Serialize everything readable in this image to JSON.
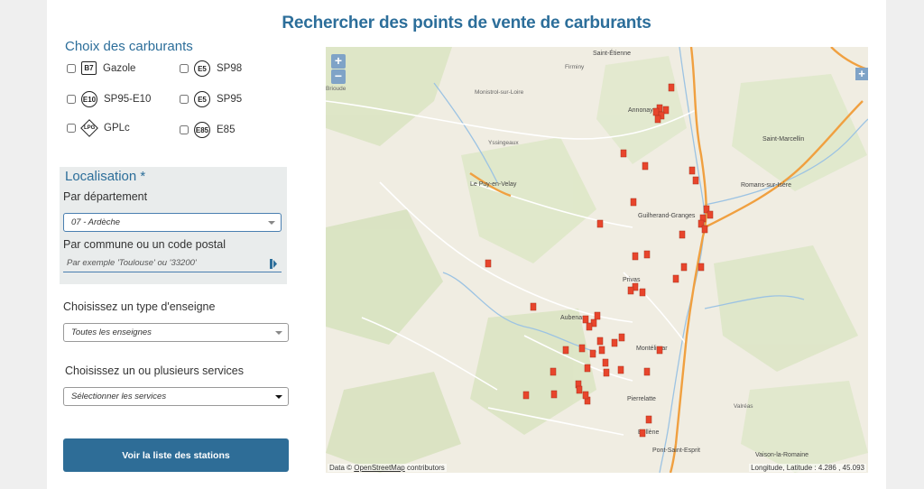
{
  "page": {
    "title": "Rechercher des points de vente de carburants"
  },
  "fuels": {
    "title": "Choix des carburants",
    "items": [
      {
        "badge": "B7",
        "label": "Gazole",
        "shape": "square"
      },
      {
        "badge": "E5",
        "label": "SP98",
        "shape": "circle"
      },
      {
        "badge": "E10",
        "label": "SP95-E10",
        "shape": "circle"
      },
      {
        "badge": "E5",
        "label": "SP95",
        "shape": "circle"
      },
      {
        "badge": "LPG",
        "label": "GPLc",
        "shape": "diamond"
      },
      {
        "badge": "E85",
        "label": "E85",
        "shape": "circle"
      }
    ]
  },
  "localisation": {
    "title": "Localisation *",
    "dept_label": "Par département",
    "dept_value": "07 - Ardèche",
    "commune_label": "Par commune ou un code postal",
    "commune_placeholder": "Par exemple 'Toulouse' ou '33200'"
  },
  "enseigne": {
    "label": "Choisissez un type d'enseigne",
    "value": "Toutes les enseignes"
  },
  "services": {
    "label": "Choisissez un ou plusieurs services",
    "value": "Sélectionner les services"
  },
  "submit_label": "Voir la liste des stations",
  "map": {
    "zoom_in": "+",
    "zoom_out": "−",
    "expand": "+",
    "attribution_prefix": "Data ©",
    "attribution_link": "OpenStreetMap",
    "attribution_suffix": "contributors",
    "coords": "Longitude, Latitude : 4.286 , 45.093",
    "places": [
      "Saint-Étienne",
      "Firminy",
      "Brioude",
      "Monistrol-sur-Loire",
      "Annonay",
      "Yssingeaux",
      "Saint-Marcellin",
      "Le Puy-en-Velay",
      "Romans-sur-Isère",
      "Guilherand-Granges",
      "Privas",
      "Aubenas",
      "Montélimar",
      "Pierrelatte",
      "Valréas",
      "Bollène",
      "Pont-Saint-Esprit",
      "Vaison-la-Romaine"
    ],
    "station_color": "#e8452c",
    "highway_color": "#f0a040"
  }
}
